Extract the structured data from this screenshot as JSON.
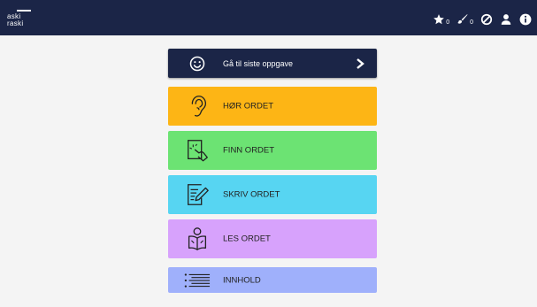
{
  "app": {
    "logo_line1": "aski",
    "logo_line2": "raski"
  },
  "topbar": {
    "star_count": "0",
    "brush_count": "0",
    "icons": [
      "star-icon",
      "brush-icon",
      "block-icon",
      "user-icon",
      "info-icon"
    ]
  },
  "menu": {
    "last_task_label": "Gå til siste oppgave",
    "hor_label": "HØR ORDET",
    "finn_label": "FINN ORDET",
    "skriv_label": "SKRIV ORDET",
    "les_label": "LES ORDET",
    "innhold_label": "INNHOLD"
  },
  "colors": {
    "topbar": "#1b2547",
    "hor": "#fdb515",
    "finn": "#6ce373",
    "skriv": "#57d5f2",
    "les": "#d7a2fc",
    "innhold": "#9fb0fb"
  }
}
